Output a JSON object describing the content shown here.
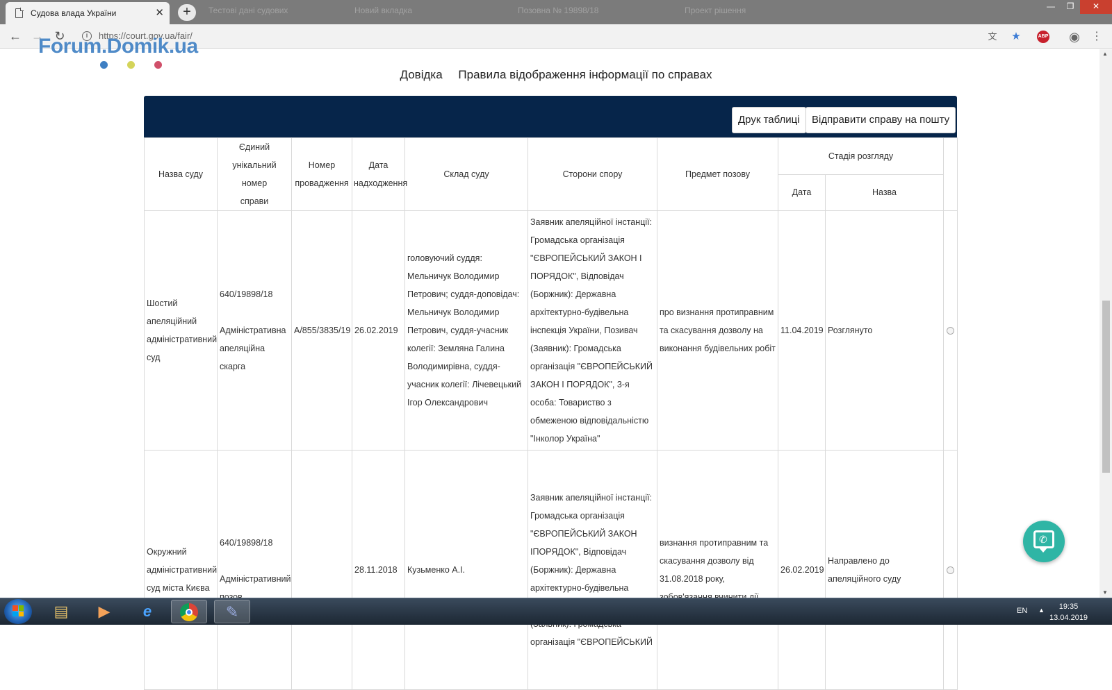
{
  "browser": {
    "tab_title": "Судова влада України",
    "tab_close": "✕",
    "new_tab": "+",
    "bg_tabs": [
      "Тестові дані судових",
      "Новий вкладка",
      "Позовна № 19898/18",
      "Проект рішення"
    ],
    "url": "https://court.gov.ua/fair/",
    "nav": {
      "back": "←",
      "forward": "→",
      "reload": "↻"
    },
    "abp_label": "ABP",
    "window_controls": {
      "minimize": "—",
      "restore": "❐",
      "close": "✕"
    }
  },
  "watermark": {
    "text": "Forum.Domik.ua",
    "dot_colors": [
      "#3e7fc3",
      "#d4d45a",
      "#d0506a"
    ]
  },
  "links": [
    "Довідка",
    "Правила відображення інформації по справах"
  ],
  "buttons": {
    "print": "Друк таблиці",
    "send_mail": "Відправити справу на пошту"
  },
  "table": {
    "headers": {
      "court": "Назва суду",
      "case_number": [
        "Єдиний",
        "унікальний номер",
        "справи"
      ],
      "proceeding": [
        "Номер",
        "провадження"
      ],
      "received": [
        "Дата",
        "надходження"
      ],
      "judges": "Склад суду",
      "parties": "Сторони спору",
      "subject": "Предмет позову",
      "stage": "Стадія розгляду",
      "stage_date": "Дата",
      "stage_name": "Назва"
    },
    "rows": [
      {
        "court": "Шостий апеляційний адміністративний суд",
        "case_number": "640/19898/18",
        "case_type": "Адміністративна апеляційна скарга",
        "proceeding": "А/855/3835/19",
        "received": "26.02.2019",
        "judges": "головуючий суддя: Мельничук Володимир Петрович; суддя-доповідач: Мельничук Володимир Петрович, суддя-учасник колегії: Земляна Галина Володимирівна, суддя-учасник колегії: Лічевецький Ігор Олександрович",
        "parties": "Заявник апеляційної інстанції: Громадська організація \"ЄВРОПЕЙСЬКИЙ ЗАКОН І ПОРЯДОК\", Відповідач (Боржник): Державна архітектурно-будівельна інспекція України, Позивач (Заявник): Громадська організація \"ЄВРОПЕЙСЬКИЙ ЗАКОН І ПОРЯДОК\", 3-я особа: Товариство з обмеженою відповідальністю \"Інколор Україна\"",
        "subject": "про визнання протиправним та скасування дозволу на виконання будівельних робіт",
        "stage_date": "11.04.2019",
        "stage_name": "Розглянуто"
      },
      {
        "court": "Окружний адміністративний суд міста Києва",
        "case_number": "640/19898/18",
        "case_type": "Адміністративний позов",
        "proceeding": "",
        "received": "28.11.2018",
        "judges": "Кузьменко А.І.",
        "parties": "Заявник апеляційної інстанції: Громадська організація \"ЄВРОПЕЙСЬКИЙ ЗАКОН ІПОРЯДОК\", Відповідач (Боржник): Державна архітектурно-будівельна інспекція України, Позивач (Заявник): Громадська організація \"ЄВРОПЕЙСЬКИЙ",
        "subject": "визнання протиправним та скасування дозволу від 31.08.2018 року, зобов'язання вчинити дії",
        "stage_date": "26.02.2019",
        "stage_name": "Направлено до апеляційного суду"
      }
    ]
  },
  "taskbar": {
    "lang": "EN",
    "time": "19:35",
    "date": "13.04.2019",
    "apps": [
      "file-explorer",
      "media-player",
      "internet-explorer",
      "chrome",
      "paint"
    ]
  }
}
